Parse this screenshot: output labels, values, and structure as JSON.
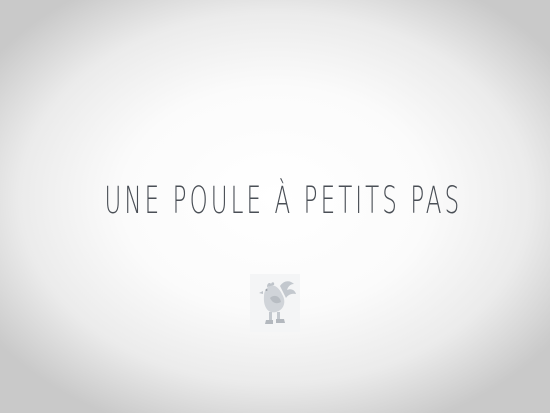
{
  "screen": {
    "title": "UNE POULE À PETITS PAS",
    "logo_icon": "chicken-logo-icon",
    "text_color": "#4a4f56",
    "logo_color": "#c3c8ce"
  }
}
